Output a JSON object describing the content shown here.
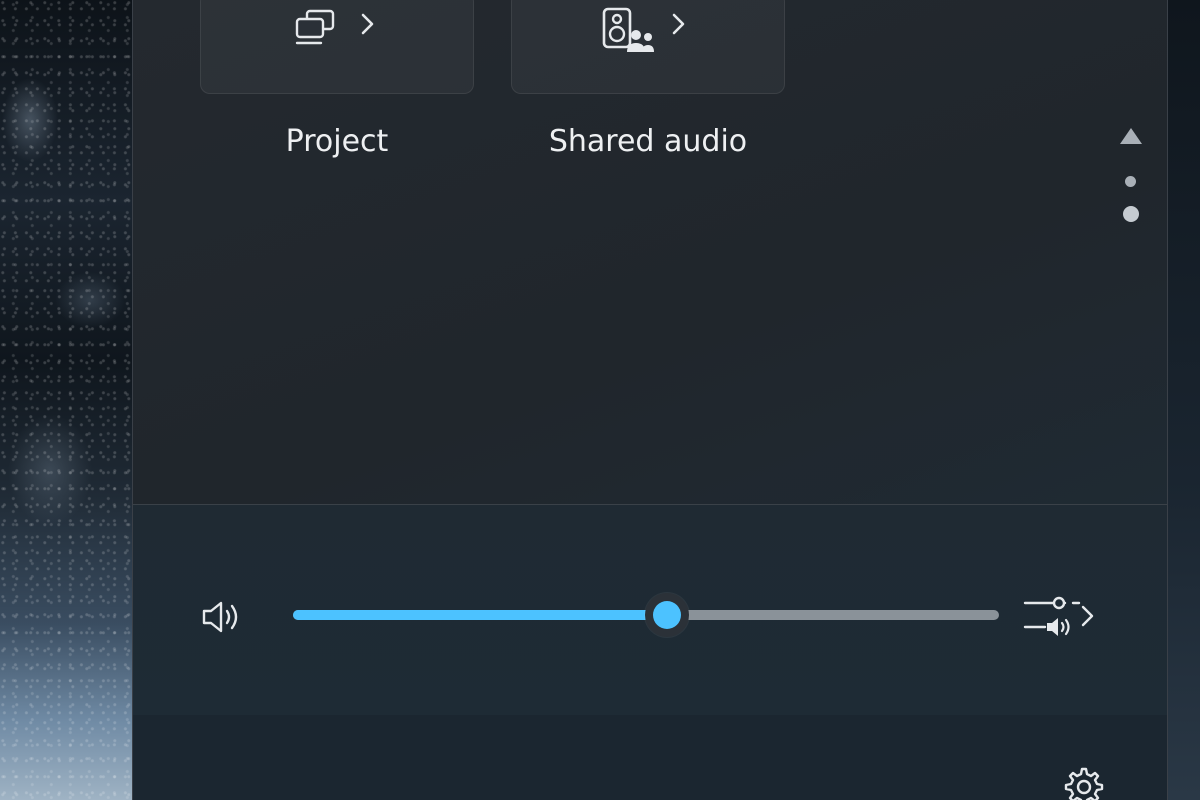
{
  "quick_settings": {
    "tiles": [
      {
        "label": "Project",
        "icon": "project-icon",
        "chevron": "chevron-right-icon"
      },
      {
        "label": "Shared audio",
        "icon": "shared-audio-icon",
        "chevron": "chevron-right-icon"
      }
    ],
    "pager": {
      "up_icon": "triangle-up-icon",
      "page_count": 2,
      "current_page": 2
    }
  },
  "volume": {
    "icon": "speaker-icon",
    "level": 0.53,
    "mixer_icon": "sound-mixer-icon",
    "mixer_chevron": "chevron-right-icon"
  },
  "footer": {
    "settings_icon": "gear-icon"
  },
  "colors": {
    "accent": "#4cc2ff",
    "panel": "#20262c",
    "text": "#eef0f2"
  }
}
